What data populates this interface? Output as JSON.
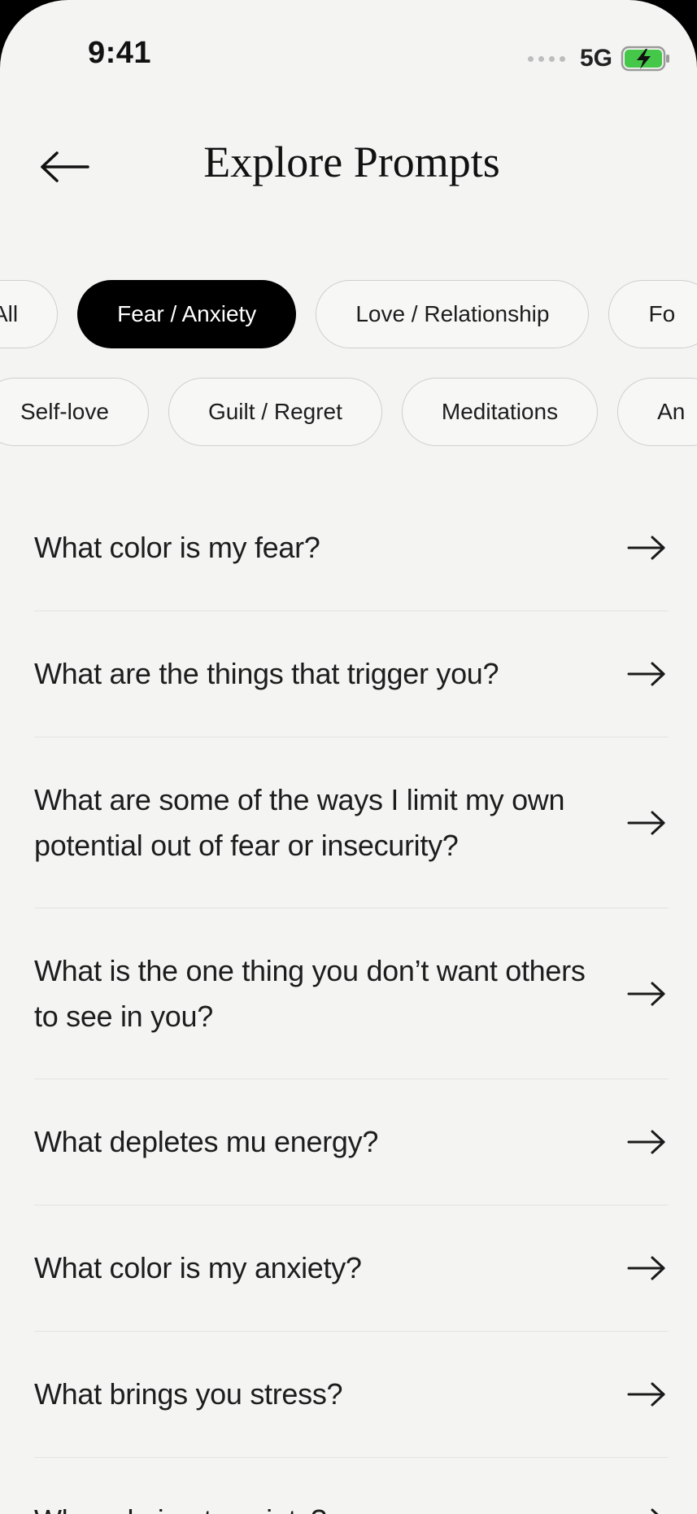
{
  "status_bar": {
    "time": "9:41",
    "network": "5G"
  },
  "header": {
    "title": "Explore Prompts",
    "back_icon": "arrow-left-icon"
  },
  "filters": {
    "row1": [
      "All",
      "Fear / Anxiety",
      "Love / Relationship",
      "Fo"
    ],
    "row2": [
      "Self-love",
      "Guilt / Regret",
      "Meditations",
      "An"
    ],
    "active": "Fear / Anxiety"
  },
  "prompts": [
    "What color is my fear?",
    "What are the things that trigger you?",
    "What are some of the ways I limit my own potential out of fear or insecurity?",
    "What is the one thing you don’t want others to see in you?",
    "What depletes mu energy?",
    "What color is my anxiety?",
    "What brings you stress?",
    "When do i get anxiety?"
  ],
  "colors": {
    "background": "#f4f4f3",
    "active_chip": "#000000",
    "text": "#1d1d1d",
    "divider": "#e3e3e1"
  }
}
